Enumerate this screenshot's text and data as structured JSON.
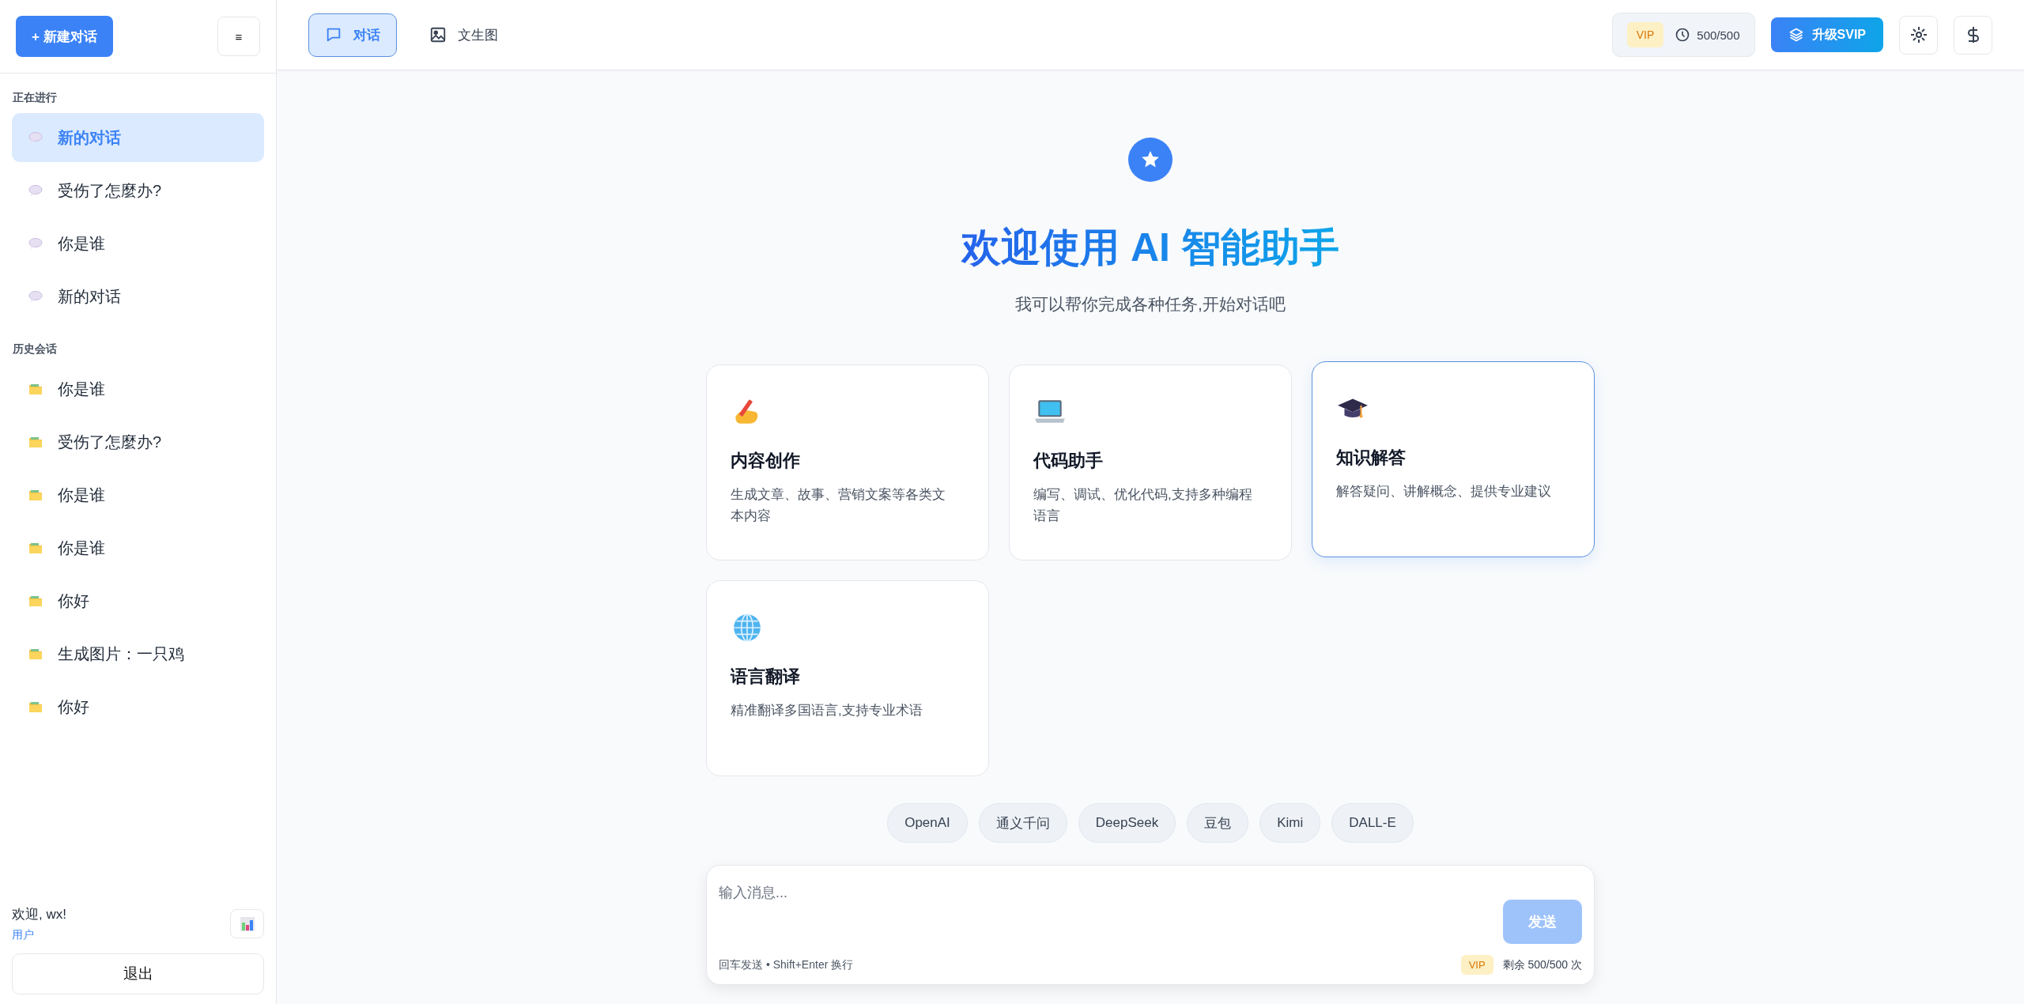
{
  "sidebar": {
    "new_chat_button": "+ 新建对话",
    "menu_button": "≡",
    "sections": [
      {
        "title": "正在进行",
        "kind": "chat",
        "items": [
          {
            "label": "新的对话",
            "selected": true
          },
          {
            "label": "受伤了怎麼办?",
            "selected": false
          },
          {
            "label": "你是谁",
            "selected": false
          },
          {
            "label": "新的对话",
            "selected": false
          }
        ]
      },
      {
        "title": "历史会话",
        "kind": "history",
        "items": [
          {
            "label": "你是谁",
            "selected": false
          },
          {
            "label": "受伤了怎麼办?",
            "selected": false
          },
          {
            "label": "你是谁",
            "selected": false
          },
          {
            "label": "你是谁",
            "selected": false
          },
          {
            "label": "你好",
            "selected": false
          },
          {
            "label": "生成图片：一只鸡",
            "selected": false
          },
          {
            "label": "你好",
            "selected": false
          }
        ]
      }
    ],
    "user": {
      "greeting": "欢迎, wx!",
      "role": "用户"
    },
    "logout_button": "退出"
  },
  "header": {
    "tabs": [
      {
        "label": "对话",
        "kind": "chat",
        "selected": true
      },
      {
        "label": "文生图",
        "kind": "image",
        "selected": false
      }
    ],
    "vip_badge": "VIP",
    "quota": "500/500",
    "upgrade_button": "升级SVIP"
  },
  "welcome": {
    "title": "欢迎使用 AI 智能助手",
    "subtitle": "我可以帮你完成各种任务,开始对话吧"
  },
  "features": [
    {
      "kind": "writing",
      "title": "内容创作",
      "description": "生成文章、故事、营销文案等各类文本内容",
      "selected": false
    },
    {
      "kind": "code",
      "title": "代码助手",
      "description": "编写、调试、优化代码,支持多种编程语言",
      "selected": false
    },
    {
      "kind": "knowledge",
      "title": "知识解答",
      "description": "解答疑问、讲解概念、提供专业建议",
      "selected": true
    },
    {
      "kind": "translate",
      "title": "语言翻译",
      "description": "精准翻译多国语言,支持专业术语",
      "selected": false
    }
  ],
  "models": [
    "OpenAI",
    "通义千问",
    "DeepSeek",
    "豆包",
    "Kimi",
    "DALL-E"
  ],
  "composer": {
    "placeholder": "输入消息...",
    "send_button": "发送",
    "send_disabled": true,
    "hint": "回车发送 • Shift+Enter 换行",
    "vip_badge": "VIP",
    "remaining": "剩余 500/500 次"
  }
}
